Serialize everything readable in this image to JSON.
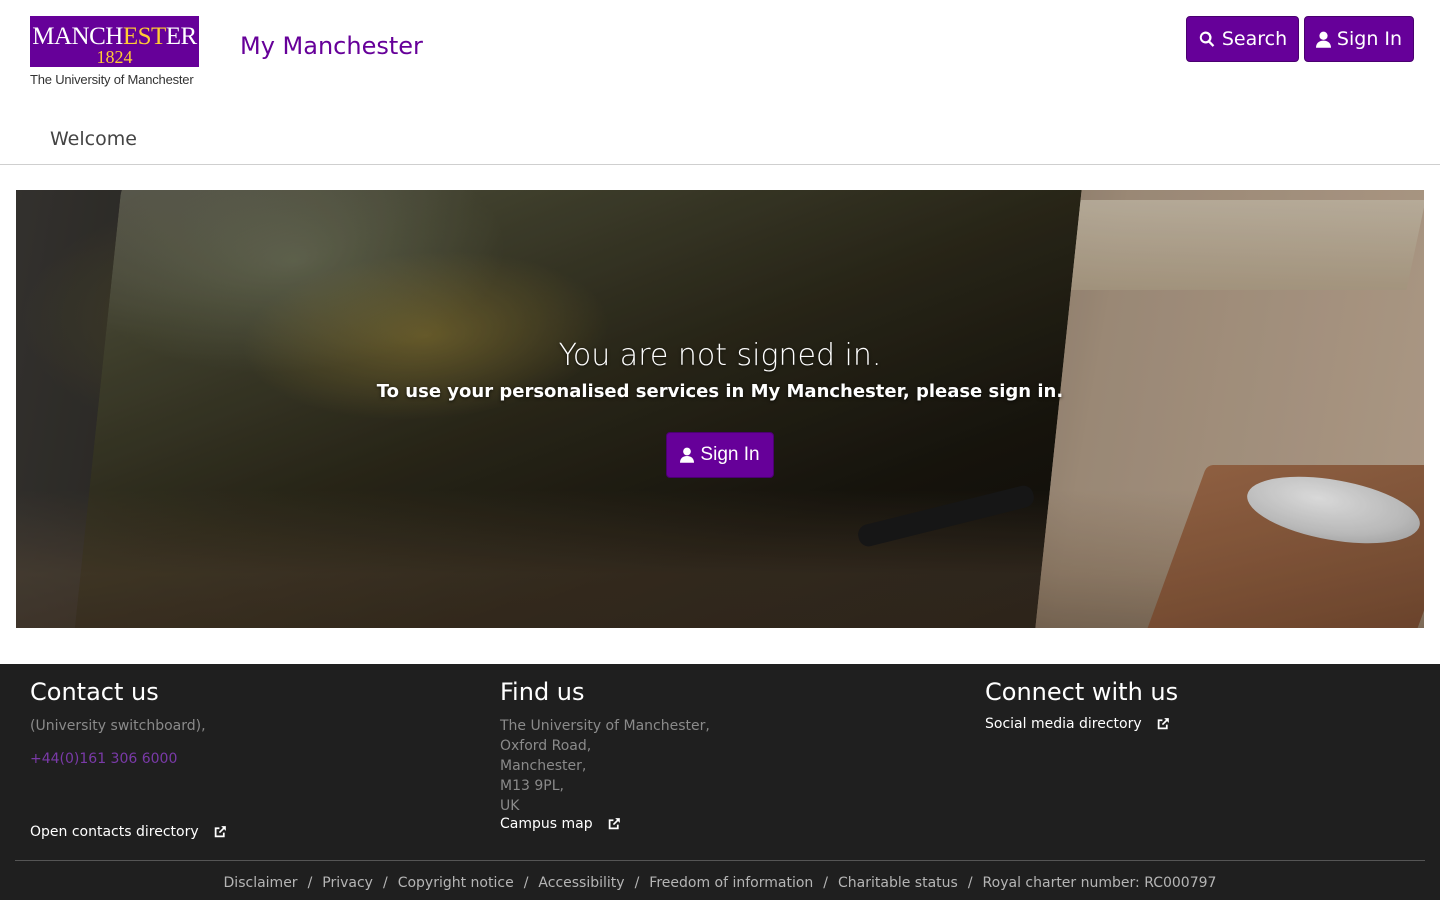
{
  "header": {
    "logo": {
      "word_a": "MANCH",
      "word_b": "EST",
      "word_c": "ER",
      "year": "1824",
      "sub": "The University of Manchester"
    },
    "site_title": "My Manchester",
    "search_label": "Search",
    "signin_label": "Sign In",
    "nav_welcome": "Welcome"
  },
  "hero": {
    "title": "You are not signed in.",
    "subtitle": "To use your personalised services in My Manchester, please sign in.",
    "signin_label": "Sign In"
  },
  "footer": {
    "contact": {
      "heading": "Contact us",
      "switchboard": "(University switchboard),",
      "phone": "+44(0)161 306 6000",
      "directory_link": "Open contacts directory"
    },
    "find": {
      "heading": "Find us",
      "address": [
        "The University of Manchester,",
        "Oxford Road,",
        "Manchester,",
        "M13 9PL,",
        "UK"
      ],
      "map_link": "Campus map"
    },
    "connect": {
      "heading": "Connect with us",
      "social_link": "Social media directory"
    },
    "legal": [
      "Disclaimer",
      "Privacy",
      "Copyright notice",
      "Accessibility",
      "Freedom of information",
      "Charitable status",
      "Royal charter number: RC000797"
    ],
    "legal_separator": "/"
  },
  "colors": {
    "brand_purple": "#660099",
    "brand_gold": "#ffcc33",
    "footer_bg": "#1f1f1f"
  },
  "icons": [
    "search-icon",
    "user-icon",
    "external-link-icon"
  ]
}
